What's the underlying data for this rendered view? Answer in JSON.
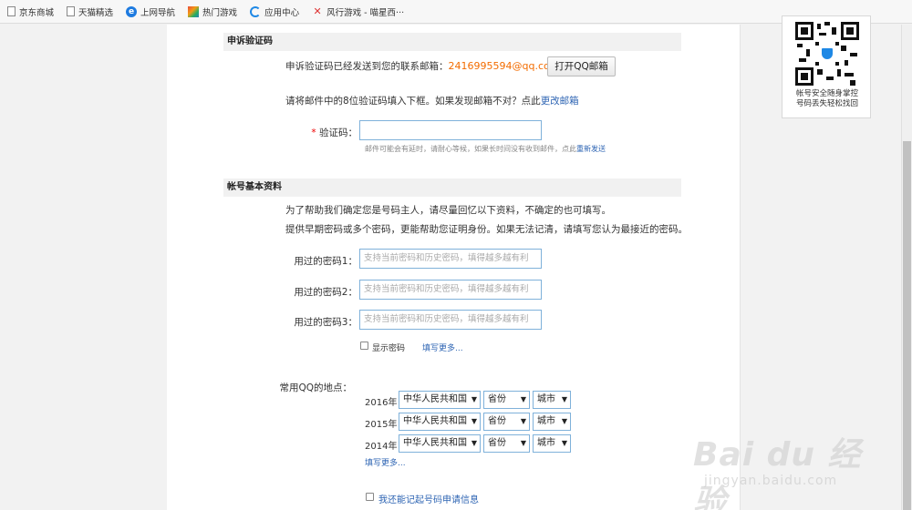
{
  "bookmarks": [
    {
      "label": "京东商城",
      "icon": "page-icon"
    },
    {
      "label": "天猫精选",
      "icon": "page-icon"
    },
    {
      "label": "上网导航",
      "icon": "ie-icon"
    },
    {
      "label": "热门游戏",
      "icon": "game-icon"
    },
    {
      "label": "应用中心",
      "icon": "app-center-icon"
    },
    {
      "label": "风行游戏 - 喵星西···",
      "icon": "fengxing-icon"
    }
  ],
  "sidebar": {
    "qr_caption_line1": "帐号安全随身掌控",
    "qr_caption_line2": "号码丢失轻松找回",
    "accent": "#1e88e5"
  },
  "appeal_code": {
    "title": "申诉验证码",
    "sent_text": "申诉验证码已经发送到您的联系邮箱：",
    "email": "2416995594@qq.com",
    "open_mail_button": "打开QQ邮箱",
    "instruction": "请将邮件中的8位验证码填入下框。如果发现邮箱不对？点此",
    "change_email_link": "更改邮箱",
    "required_mark": "*",
    "code_label": "验证码：",
    "code_value": "",
    "hint": "邮件可能会有延时，请耐心等候，如果长时间没有收到邮件，点此",
    "resend_link": "重新发送"
  },
  "basic_info": {
    "title": "帐号基本资料",
    "desc_line1": "为了帮助我们确定您是号码主人，请尽量回忆以下资料，不确定的也可填写。",
    "desc_line2": "提供早期密码或多个密码，更能帮助您证明身份。如果无法记清，请填写您认为最接近的密码。",
    "passwords": [
      {
        "label": "用过的密码1：",
        "placeholder": "支持当前密码和历史密码，填得越多越有利"
      },
      {
        "label": "用过的密码2：",
        "placeholder": "支持当前密码和历史密码，填得越多越有利"
      },
      {
        "label": "用过的密码3：",
        "placeholder": "支持当前密码和历史密码，填得越多越有利"
      }
    ],
    "show_password_label": "显示密码",
    "fill_more_link": "填写更多...",
    "location_label": "常用QQ的地点：",
    "locations": [
      {
        "year": "2016年",
        "country": "中华人民共和国",
        "province": "省份",
        "city": "城市"
      },
      {
        "year": "2015年",
        "country": "中华人民共和国",
        "province": "省份",
        "city": "城市"
      },
      {
        "year": "2014年",
        "country": "中华人民共和国",
        "province": "省份",
        "city": "城市"
      }
    ],
    "location_more_link": "填写更多...",
    "remember_apply_label": "我还能记起号码申请信息"
  },
  "watermark": {
    "brand": "Bai du 经验",
    "url": "jingyan.baidu.com"
  }
}
